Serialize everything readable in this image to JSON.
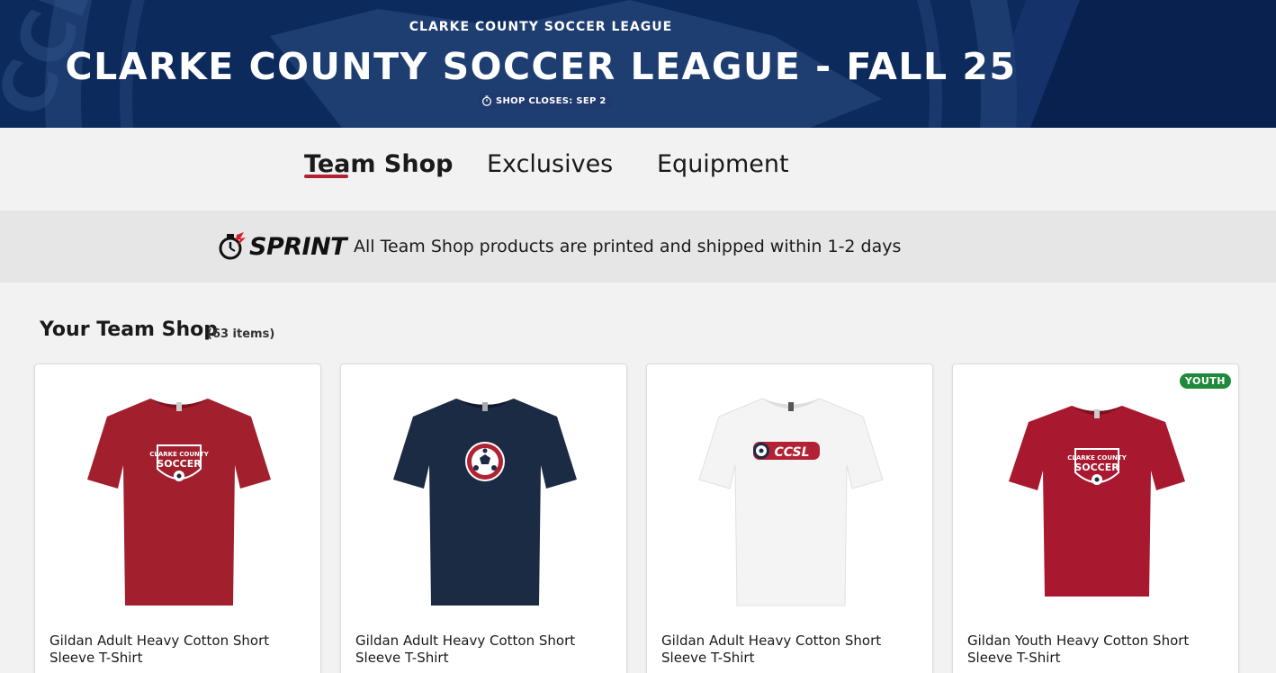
{
  "banner": {
    "kicker": "CLARKE COUNTY SOCCER LEAGUE",
    "title": "CLARKE COUNTY SOCCER LEAGUE - FALL 25",
    "shop_closes": "SHOP CLOSES: SEP 2",
    "bg_color": "#0d2a5c"
  },
  "tabs": [
    {
      "label": "Team Shop",
      "active": true
    },
    {
      "label": "Exclusives",
      "active": false
    },
    {
      "label": "Equipment",
      "active": false
    }
  ],
  "sprint": {
    "logo_text": "SPRINT",
    "message": "All Team Shop products are printed and shipped within 1-2 days"
  },
  "section": {
    "title": "Your Team Shop",
    "count": "(63 items)"
  },
  "products": [
    {
      "name": "Gildan Adult Heavy Cotton Short Sleeve T-Shirt",
      "shirt_color": "#a21f2d",
      "design": "clarke-county-soccer-crest",
      "badge": ""
    },
    {
      "name": "Gildan Adult Heavy Cotton Short Sleeve T-Shirt",
      "shirt_color": "#1c2b44",
      "design": "soccer-ball-circle-logo",
      "badge": ""
    },
    {
      "name": "Gildan Adult Heavy Cotton Short Sleeve T-Shirt",
      "shirt_color": "#f4f4f4",
      "design": "ccsl-wordmark",
      "badge": ""
    },
    {
      "name": "Gildan Youth Heavy Cotton Short Sleeve T-Shirt",
      "shirt_color": "#a8182f",
      "design": "clarke-county-soccer-crest",
      "badge": "YOUTH"
    }
  ],
  "colors": {
    "accent": "#b22234",
    "youth_badge": "#1e8a3a"
  }
}
